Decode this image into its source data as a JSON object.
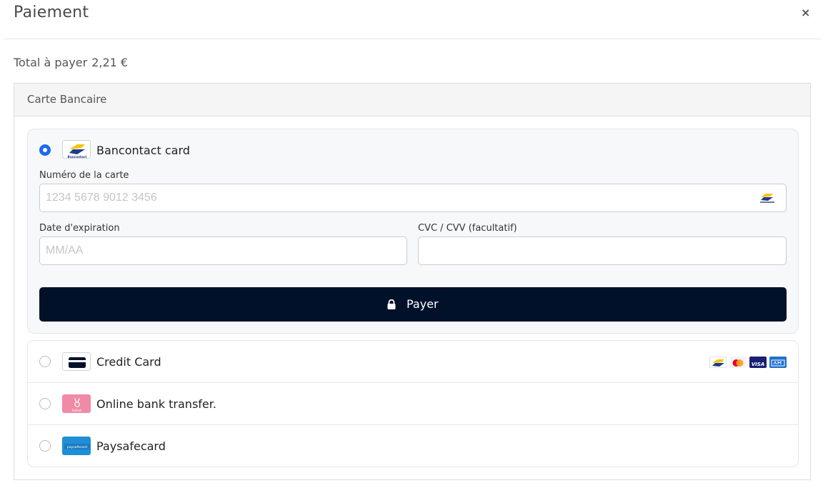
{
  "modal": {
    "title": "Paiement",
    "close_label": "×"
  },
  "total": {
    "label": "Total à payer",
    "amount": "2,21 €"
  },
  "panel": {
    "title": "Carte Bancaire"
  },
  "bancontact": {
    "label": "Bancontact card",
    "selected": true,
    "logo_text": "Bancontact",
    "card_number_label": "Numéro de la carte",
    "card_number_placeholder": "1234 5678 9012 3456",
    "card_number_value": "",
    "expiry_label": "Date d'expiration",
    "expiry_placeholder": "MM/AA",
    "expiry_value": "",
    "cvc_label": "CVC / CVV (facultatif)",
    "cvc_placeholder": "",
    "cvc_value": "",
    "pay_button_label": "Payer",
    "pay_icon": "lock-icon"
  },
  "other_methods": [
    {
      "label": "Credit Card",
      "selected": false,
      "icon": "credit-card-icon",
      "badges": [
        "bancontact-badge-icon",
        "mastercard-badge-icon",
        "visa-badge-icon",
        "amex-badge-icon"
      ],
      "visa_text": "VISA"
    },
    {
      "label": "Online bank transfer.",
      "selected": false,
      "icon": "sofort-logo-icon",
      "logo_text": "Sofort."
    },
    {
      "label": "Paysafecard",
      "selected": false,
      "icon": "paysafecard-logo-icon",
      "logo_text": "paysafecard"
    }
  ],
  "colors": {
    "primary_button": "#02112a",
    "radio_selected": "#1a6cf0",
    "sofort_pink": "#f08aa6",
    "paysafe_blue": "#1e8fd6"
  }
}
